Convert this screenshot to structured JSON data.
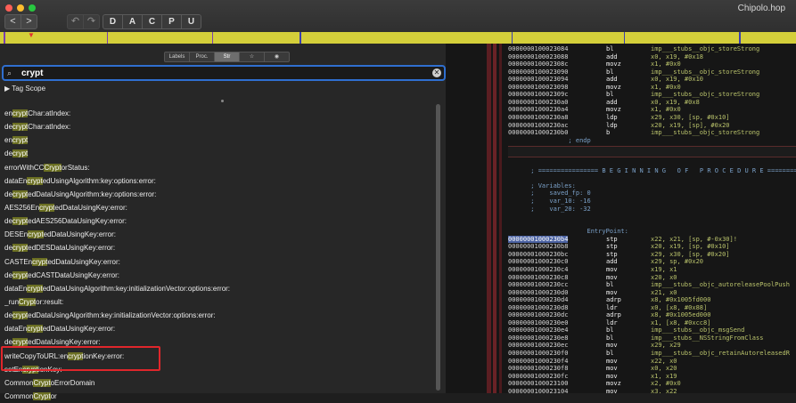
{
  "window": {
    "title": "Chipolo.hop"
  },
  "toolbar": {
    "back": "<",
    "forward": ">",
    "undo": "↶",
    "redo": "↷",
    "modes": [
      "D",
      "A",
      "C",
      "P",
      "U"
    ]
  },
  "left_panel": {
    "segments": [
      "Labels",
      "Proc.",
      "Str",
      "☆",
      "◉"
    ],
    "search": {
      "value": "crypt"
    },
    "tag_scope": "▶ Tag Scope",
    "items": [
      [
        {
          "t": "en"
        },
        {
          "t": "crypt",
          "h": 1
        },
        {
          "t": "Char:atIndex:"
        }
      ],
      [
        {
          "t": "de"
        },
        {
          "t": "crypt",
          "h": 1
        },
        {
          "t": "Char:atIndex:"
        }
      ],
      [
        {
          "t": "en"
        },
        {
          "t": "crypt",
          "h": 1
        }
      ],
      [
        {
          "t": "de"
        },
        {
          "t": "crypt",
          "h": 1
        }
      ],
      [
        {
          "t": "errorWithCC"
        },
        {
          "t": "Crypt",
          "h": 1
        },
        {
          "t": "orStatus:"
        }
      ],
      [
        {
          "t": "dataEn"
        },
        {
          "t": "crypt",
          "h": 1
        },
        {
          "t": "edUsingAlgorithm:key:options:error:"
        }
      ],
      [
        {
          "t": "de"
        },
        {
          "t": "crypt",
          "h": 1
        },
        {
          "t": "edDataUsingAlgorithm:key:options:error:"
        }
      ],
      [
        {
          "t": "AES256En"
        },
        {
          "t": "crypt",
          "h": 1
        },
        {
          "t": "edDataUsingKey:error:"
        }
      ],
      [
        {
          "t": "de"
        },
        {
          "t": "crypt",
          "h": 1
        },
        {
          "t": "edAES256DataUsingKey:error:"
        }
      ],
      [
        {
          "t": "DESEn"
        },
        {
          "t": "crypt",
          "h": 1
        },
        {
          "t": "edDataUsingKey:error:"
        }
      ],
      [
        {
          "t": "de"
        },
        {
          "t": "crypt",
          "h": 1
        },
        {
          "t": "edDESDataUsingKey:error:"
        }
      ],
      [
        {
          "t": "CASTEn"
        },
        {
          "t": "crypt",
          "h": 1
        },
        {
          "t": "edDataUsingKey:error:"
        }
      ],
      [
        {
          "t": "de"
        },
        {
          "t": "crypt",
          "h": 1
        },
        {
          "t": "edCASTDataUsingKey:error:"
        }
      ],
      [
        {
          "t": "dataEn"
        },
        {
          "t": "crypt",
          "h": 1
        },
        {
          "t": "edDataUsingAlgorithm:key:initializationVector:options:error:"
        }
      ],
      [
        {
          "t": "_run"
        },
        {
          "t": "Crypt",
          "h": 1
        },
        {
          "t": "or:result:"
        }
      ],
      [
        {
          "t": "de"
        },
        {
          "t": "crypt",
          "h": 1
        },
        {
          "t": "edDataUsingAlgorithm:key:initializationVector:options:error:"
        }
      ],
      [
        {
          "t": "dataEn"
        },
        {
          "t": "crypt",
          "h": 1
        },
        {
          "t": "edDataUsingKey:error:"
        }
      ],
      [
        {
          "t": "de"
        },
        {
          "t": "crypt",
          "h": 1
        },
        {
          "t": "edDataUsingKey:error:"
        }
      ],
      [
        {
          "t": "writeCopyToURL:en"
        },
        {
          "t": "crypt",
          "h": 1
        },
        {
          "t": "ionKey:error:"
        }
      ],
      [
        {
          "t": "setEn"
        },
        {
          "t": "crypt",
          "h": 1
        },
        {
          "t": "ionKey:"
        }
      ],
      [
        {
          "t": "Common"
        },
        {
          "t": "Crypt",
          "h": 1
        },
        {
          "t": "oErrorDomain"
        }
      ],
      [
        {
          "t": "Common"
        },
        {
          "t": "Crypt",
          "h": 1
        },
        {
          "t": "or"
        }
      ]
    ]
  },
  "disassembly": {
    "lines": [
      {
        "kind": "ins",
        "addr": "0000000100023084",
        "mn": "bl",
        "op": "imp___stubs__objc_storeStrong"
      },
      {
        "kind": "ins",
        "addr": "0000000100023088",
        "mn": "add",
        "op": "x0, x19, #0x18"
      },
      {
        "kind": "ins",
        "addr": "000000010002308c",
        "mn": "movz",
        "op": "x1, #0x0"
      },
      {
        "kind": "ins",
        "addr": "0000000100023090",
        "mn": "bl",
        "op": "imp___stubs__objc_storeStrong"
      },
      {
        "kind": "ins",
        "addr": "0000000100023094",
        "mn": "add",
        "op": "x0, x19, #0x10"
      },
      {
        "kind": "ins",
        "addr": "0000000100023098",
        "mn": "movz",
        "op": "x1, #0x0"
      },
      {
        "kind": "ins",
        "addr": "000000010002309c",
        "mn": "bl",
        "op": "imp___stubs__objc_storeStrong"
      },
      {
        "kind": "ins",
        "addr": "00000001000230a0",
        "mn": "add",
        "op": "x0, x19, #0x8"
      },
      {
        "kind": "ins",
        "addr": "00000001000230a4",
        "mn": "movz",
        "op": "x1, #0x0"
      },
      {
        "kind": "ins",
        "addr": "00000001000230a8",
        "mn": "ldp",
        "op": "x29, x30, [sp, #0x10]"
      },
      {
        "kind": "ins",
        "addr": "00000001000230ac",
        "mn": "ldp",
        "op": "x20, x19, [sp], #0x20"
      },
      {
        "kind": "ins",
        "addr": "00000001000230b0",
        "mn": "b",
        "op": "imp___stubs__objc_storeStrong"
      },
      {
        "kind": "txt",
        "text": "                ; endp"
      },
      {
        "kind": "bar"
      },
      {
        "kind": "blank"
      },
      {
        "kind": "blank"
      },
      {
        "kind": "txt",
        "text": "      ; ================ B E G I N N I N G   O F   P R O C E D U R E ================"
      },
      {
        "kind": "blank"
      },
      {
        "kind": "txt",
        "text": "      ; Variables:"
      },
      {
        "kind": "txt",
        "text": "      ;    saved_fp: 0"
      },
      {
        "kind": "txt",
        "text": "      ;    var_10: -16"
      },
      {
        "kind": "txt",
        "text": "      ;    var_20: -32"
      },
      {
        "kind": "blank"
      },
      {
        "kind": "blank"
      },
      {
        "kind": "txt",
        "text": "                     EntryPoint:"
      },
      {
        "kind": "ins",
        "addr": "00000001000230b4",
        "sel": 1,
        "mn": "stp",
        "op": "x22, x21, [sp, #-0x30]!"
      },
      {
        "kind": "ins",
        "addr": "00000001000230b8",
        "mn": "stp",
        "op": "x20, x19, [sp, #0x10]"
      },
      {
        "kind": "ins",
        "addr": "00000001000230bc",
        "mn": "stp",
        "op": "x29, x30, [sp, #0x20]"
      },
      {
        "kind": "ins",
        "addr": "00000001000230c0",
        "mn": "add",
        "op": "x29, sp, #0x20"
      },
      {
        "kind": "ins",
        "addr": "00000001000230c4",
        "mn": "mov",
        "op": "x19, x1"
      },
      {
        "kind": "ins",
        "addr": "00000001000230c8",
        "mn": "mov",
        "op": "x20, x0"
      },
      {
        "kind": "ins",
        "addr": "00000001000230cc",
        "mn": "bl",
        "op": "imp___stubs__objc_autoreleasePoolPush"
      },
      {
        "kind": "ins",
        "addr": "00000001000230d0",
        "mn": "mov",
        "op": "x21, x0"
      },
      {
        "kind": "ins",
        "addr": "00000001000230d4",
        "mn": "adrp",
        "op": "x8, #0x1005fd000"
      },
      {
        "kind": "ins",
        "addr": "00000001000230d8",
        "mn": "ldr",
        "op": "x0, [x8, #0x88]"
      },
      {
        "kind": "ins",
        "addr": "00000001000230dc",
        "mn": "adrp",
        "op": "x8, #0x1005ed000"
      },
      {
        "kind": "ins",
        "addr": "00000001000230e0",
        "mn": "ldr",
        "op": "x1, [x8, #0xcc8]"
      },
      {
        "kind": "ins",
        "addr": "00000001000230e4",
        "mn": "bl",
        "op": "imp___stubs__objc_msgSend"
      },
      {
        "kind": "ins",
        "addr": "00000001000230e8",
        "mn": "bl",
        "op": "imp___stubs__NSStringFromClass"
      },
      {
        "kind": "ins",
        "addr": "00000001000230ec",
        "mn": "mov",
        "op": "x29, x29"
      },
      {
        "kind": "ins",
        "addr": "00000001000230f0",
        "mn": "bl",
        "op": "imp___stubs__objc_retainAutoreleasedR"
      },
      {
        "kind": "ins",
        "addr": "00000001000230f4",
        "mn": "mov",
        "op": "x22, x0"
      },
      {
        "kind": "ins",
        "addr": "00000001000230f8",
        "mn": "mov",
        "op": "x0, x20"
      },
      {
        "kind": "ins",
        "addr": "00000001000230fc",
        "mn": "mov",
        "op": "x1, x19"
      },
      {
        "kind": "ins",
        "addr": "0000000100023100",
        "mn": "movz",
        "op": "x2, #0x0"
      },
      {
        "kind": "ins",
        "addr": "0000000100023104",
        "mn": "mov",
        "op": "x3, x22"
      }
    ]
  },
  "colors": {
    "accent": "#2f6fd0",
    "highlight": "#6b6f22",
    "navstrip": "#d4cf3a",
    "annotation": "#e0262b"
  }
}
